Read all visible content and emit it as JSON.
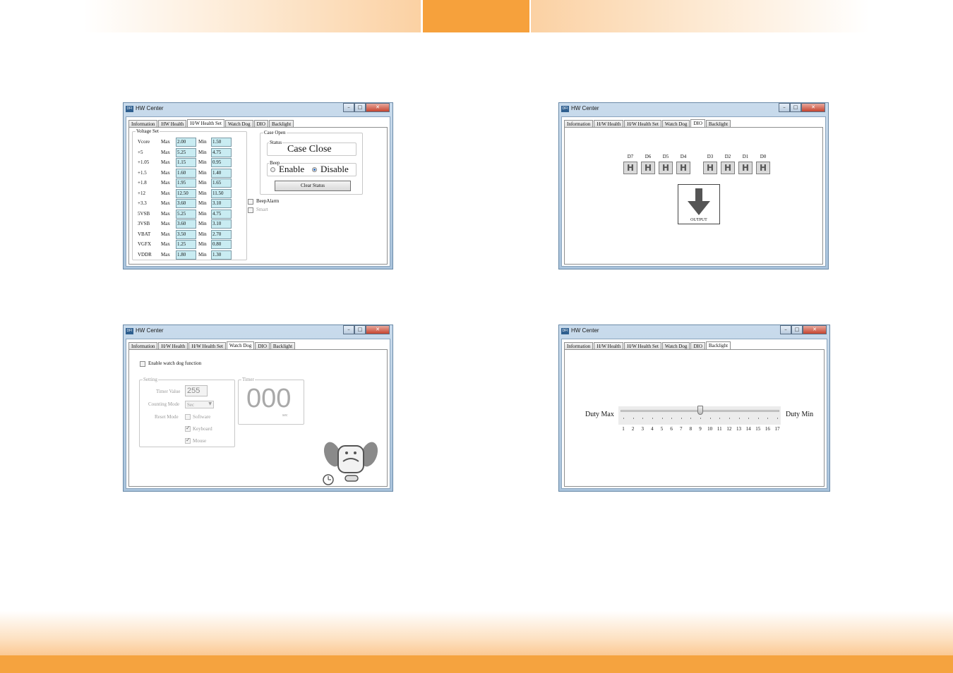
{
  "win_hwset": {
    "title": "HW Center",
    "icon": "DFI",
    "tabs": [
      "Information",
      "HW Health",
      "H/W Health Set",
      "Watch Dog",
      "DIO",
      "Backlight"
    ],
    "voltage_legend": "Voltage Set",
    "max_label": "Max",
    "min_label": "Min",
    "rows": [
      {
        "name": "Vcore",
        "max": "2.00",
        "min": "1.50"
      },
      {
        "name": "+5",
        "max": "5.25",
        "min": "4.75"
      },
      {
        "name": "+1.05",
        "max": "1.15",
        "min": "0.95"
      },
      {
        "name": "+1.5",
        "max": "1.60",
        "min": "1.40"
      },
      {
        "name": "+1.8",
        "max": "1.95",
        "min": "1.65"
      },
      {
        "name": "+12",
        "max": "12.50",
        "min": "11.50"
      },
      {
        "name": "+3.3",
        "max": "3.60",
        "min": "3.10"
      },
      {
        "name": "5VSB",
        "max": "5.25",
        "min": "4.75"
      },
      {
        "name": "3VSB",
        "max": "3.60",
        "min": "3.10"
      },
      {
        "name": "VBAT",
        "max": "3.50",
        "min": "2.70"
      },
      {
        "name": "VGFX",
        "max": "1.25",
        "min": "0.80"
      },
      {
        "name": "VDDR",
        "max": "1.80",
        "min": "1.30"
      }
    ],
    "case_legend": "Case Open",
    "status_legend": "Status",
    "status_value": "Case Close",
    "beep_legend": "Beep",
    "beep_enable": "Enable",
    "beep_disable": "Disable",
    "clear_button": "Clear Status",
    "beep_alarm": "BeepAlarm",
    "smart": "Smart"
  },
  "win_dio": {
    "title": "HW Center",
    "icon": "DFI",
    "tabs": [
      "Information",
      "H/W Health",
      "H/W Health Set",
      "Watch Dog",
      "DIO",
      "Backlight"
    ],
    "pins": [
      {
        "label": "D7",
        "state": "H"
      },
      {
        "label": "D6",
        "state": "H"
      },
      {
        "label": "D5",
        "state": "H"
      },
      {
        "label": "D4",
        "state": "H"
      },
      {
        "label": "D3",
        "state": "H"
      },
      {
        "label": "D2",
        "state": "H"
      },
      {
        "label": "D1",
        "state": "H"
      },
      {
        "label": "D0",
        "state": "H"
      }
    ],
    "output_label": "OUTPUT"
  },
  "win_wd": {
    "title": "HW Center",
    "icon": "DFI",
    "tabs": [
      "Information",
      "H/W Health",
      "H/W Health Set",
      "Watch Dog",
      "DIO",
      "Backlight"
    ],
    "enable_label": "Enable watch dog function",
    "setting_legend": "Setting",
    "timer_value_label": "Timer Value",
    "timer_value": "255",
    "counting_label": "Counting Mode",
    "counting_value": "Sec",
    "reset_label": "Reset Mode",
    "software": "Software",
    "keyboard": "Keyboard",
    "mouse": "Mouse",
    "timer_legend": "Timer",
    "timer_display": "000",
    "timer_unit": "sec"
  },
  "win_bl": {
    "title": "HW Center",
    "icon": "DFI",
    "tabs": [
      "Information",
      "H/W Health",
      "H/W Health Set",
      "Watch Dog",
      "DIO",
      "Backlight"
    ],
    "duty_max": "Duty Max",
    "duty_min": "Duty Min",
    "ticks": [
      "1",
      "2",
      "3",
      "4",
      "5",
      "6",
      "7",
      "8",
      "9",
      "10",
      "11",
      "12",
      "13",
      "14",
      "15",
      "16",
      "17"
    ],
    "slider_value": 9
  }
}
